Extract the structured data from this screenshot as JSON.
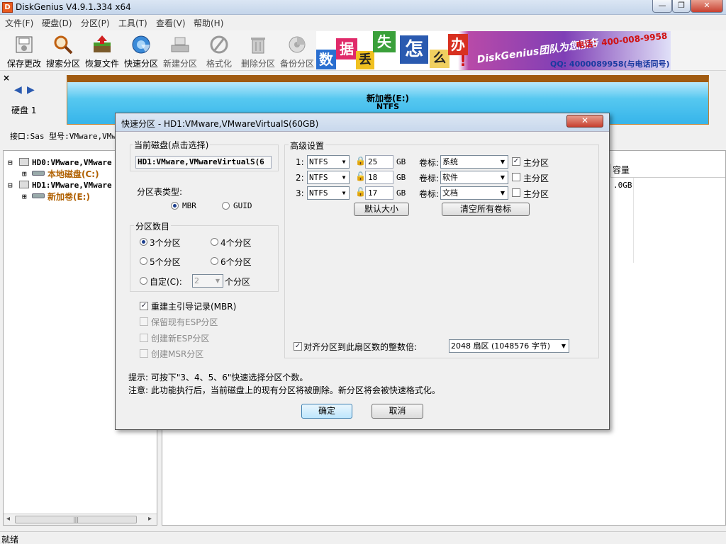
{
  "app": {
    "title": "DiskGenius V4.9.1.334 x64",
    "logo": "D"
  },
  "window_controls": {
    "minimize": "—",
    "restore": "❐",
    "close": "✕"
  },
  "menu": [
    "文件(F)",
    "硬盘(D)",
    "分区(P)",
    "工具(T)",
    "查看(V)",
    "帮助(H)"
  ],
  "toolbar": [
    {
      "label": "保存更改",
      "icon": "save-icon",
      "enabled": true
    },
    {
      "label": "搜索分区",
      "icon": "magnifier-icon",
      "enabled": true
    },
    {
      "label": "恢复文件",
      "icon": "recover-icon",
      "enabled": true
    },
    {
      "label": "快速分区",
      "icon": "quick-partition-icon",
      "enabled": true
    },
    {
      "label": "新建分区",
      "icon": "new-partition-icon",
      "enabled": false
    },
    {
      "label": "格式化",
      "icon": "format-icon",
      "enabled": false
    },
    {
      "label": "删除分区",
      "icon": "delete-icon",
      "enabled": false
    },
    {
      "label": "备份分区",
      "icon": "backup-icon",
      "enabled": false
    }
  ],
  "banner": {
    "chars": [
      "数",
      "据",
      "丢",
      "失",
      "怎",
      "么",
      "办",
      "!"
    ],
    "slogan": "DiskGenius团队为您服务",
    "phone": "电话：400-008-9958",
    "qq": "QQ: 4000089958(与电话同号)"
  },
  "disk_panel": {
    "close": "×",
    "disk_label": "硬盘 1",
    "interface_line": "接口:Sas  型号:VMware,VMw"
  },
  "volume": {
    "name": "新加卷(E:)",
    "fs": "NTFS",
    "size": "60.0GB"
  },
  "tree": {
    "items": [
      {
        "label": "HD0:VMware,VMware",
        "expander": "⊟"
      },
      {
        "label": "本地磁盘(C:)",
        "expander": "⊞"
      },
      {
        "label": "HD1:VMware,VMware",
        "expander": "⊟"
      },
      {
        "label": "新加卷(E:)",
        "expander": "⊞"
      }
    ],
    "scroll_left": "◂",
    "scroll_right": "▸",
    "grip": "|||"
  },
  "right_pane": {
    "header": "容量",
    "cell": ".0GB"
  },
  "status": "就绪",
  "dialog": {
    "title": "快速分区 - HD1:VMware,VMwareVirtualS(60GB)",
    "close": "✕",
    "current_disk_label": "当前磁盘(点击选择)",
    "current_disk_value": "HD1:VMware,VMwareVirtualS(6",
    "table_type_label": "分区表类型:",
    "table_types": [
      {
        "label": "MBR",
        "selected": true
      },
      {
        "label": "GUID",
        "selected": false
      }
    ],
    "count_label": "分区数目",
    "counts": [
      {
        "label": "3个分区",
        "selected": true
      },
      {
        "label": "4个分区",
        "selected": false
      },
      {
        "label": "5个分区",
        "selected": false
      },
      {
        "label": "6个分区",
        "selected": false
      }
    ],
    "custom_label": "自定(C):",
    "custom_value": "2",
    "custom_suffix": "个分区",
    "rebuild_mbr": {
      "label": "重建主引导记录(MBR)",
      "checked": true
    },
    "keep_esp": {
      "label": "保留现有ESP分区",
      "checked": false
    },
    "create_esp": {
      "label": "创建新ESP分区",
      "checked": false
    },
    "create_msr": {
      "label": "创建MSR分区",
      "checked": false
    },
    "advanced_label": "高级设置",
    "partitions": [
      {
        "index": "1:",
        "fs": "NTFS",
        "size": "25",
        "unit": "GB",
        "vol_label_text": "卷标:",
        "vol_label": "系统",
        "primary_label": "主分区",
        "primary": true
      },
      {
        "index": "2:",
        "fs": "NTFS",
        "size": "18",
        "unit": "GB",
        "vol_label_text": "卷标:",
        "vol_label": "软件",
        "primary_label": "主分区",
        "primary": false
      },
      {
        "index": "3:",
        "fs": "NTFS",
        "size": "17",
        "unit": "GB",
        "vol_label_text": "卷标:",
        "vol_label": "文档",
        "primary_label": "主分区",
        "primary": false
      }
    ],
    "default_size_button": "默认大小",
    "clear_labels_button": "清空所有卷标",
    "align_label": "对齐分区到此扇区数的整数倍:",
    "align_checked": true,
    "align_value": "2048 扇区 (1048576 字节)",
    "hint": "提示: 可按下\"3、4、5、6\"快速选择分区个数。",
    "notice": "注意: 此功能执行后，当前磁盘上的现有分区将被删除。新分区将会被快速格式化。",
    "ok": "确定",
    "cancel": "取消"
  },
  "colors": {
    "accent": "#1a6fc9",
    "volume_fill": "#36b4ea",
    "volume_top": "#a05a10",
    "drive_label": "#b06000"
  }
}
